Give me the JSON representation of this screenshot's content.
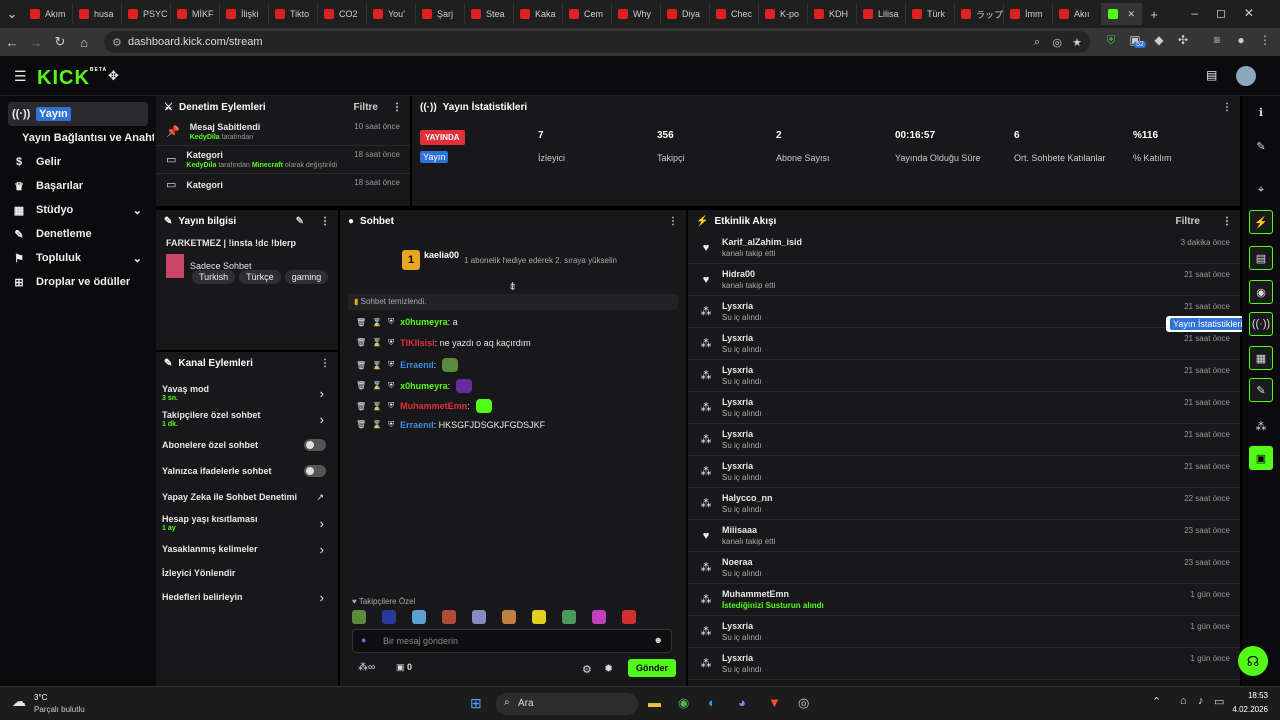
{
  "browser": {
    "tabs": [
      "Akım",
      "husa",
      "PSYC",
      "MİKF",
      "İlişki",
      "Tikto",
      "CO2",
      "You'",
      "Şarj",
      "Stea",
      "Kaka",
      "Cem",
      "Why",
      "Diya",
      "Chec",
      "K-po",
      "KDH",
      "Lilisa",
      "Türk",
      "ラップ",
      "İmm",
      "Akıı"
    ],
    "url": "dashboard.kick.com/stream",
    "extension_badge": "52"
  },
  "topnav": {
    "logo": "KICK",
    "beta": "BETA"
  },
  "sidebar": {
    "items": [
      {
        "label": "Yayın",
        "icon": "broadcast-icon",
        "active": true
      },
      {
        "label": "Yayın Bağlantısı ve Anahtarı",
        "icon": "",
        "sub": true
      },
      {
        "label": "Gelir",
        "icon": "dollar-icon"
      },
      {
        "label": "Başarılar",
        "icon": "trophy-icon"
      },
      {
        "label": "Stüdyo",
        "icon": "studio-icon",
        "chevron": true
      },
      {
        "label": "Denetleme",
        "icon": "wrench-icon"
      },
      {
        "label": "Topluluk",
        "icon": "community-icon",
        "chevron": true
      },
      {
        "label": "Droplar ve ödüller",
        "icon": "gift-icon"
      }
    ]
  },
  "mod_actions": {
    "title": "Denetim Eylemleri",
    "filter": "Filtre",
    "items": [
      {
        "title": "Mesaj Sabitlendi",
        "user": "KedyDila",
        "detail": "tarafından",
        "time": "10 saat önce"
      },
      {
        "title": "Kategori",
        "user": "KedyDila",
        "detail": "tarafından",
        "game": "Minecraft",
        "detail2": "olarak değiştirildi",
        "time": "18 saat önce"
      },
      {
        "title": "Kategori",
        "time": "18 saat önce"
      }
    ]
  },
  "stream_stats": {
    "title": "Yayın İstatistikleri",
    "live_badge": "YAYINDA",
    "live_label": "Yayın",
    "stats": [
      {
        "value": "7",
        "label": "İzleyici"
      },
      {
        "value": "356",
        "label": "Takipçi"
      },
      {
        "value": "2",
        "label": "Abone Sayısı"
      },
      {
        "value": "00:16:57",
        "label": "Yayında Olduğu Süre"
      },
      {
        "value": "6",
        "label": "Ort. Sohbete Katılanlar"
      },
      {
        "value": "%116",
        "label": "% Katılım"
      }
    ]
  },
  "stream_info": {
    "title": "Yayın bilgisi",
    "stream_title": "FARKETMEZ | !insta !dc !blerp",
    "category": "Sadece Sohbet",
    "tags": [
      "Turkish",
      "Türkçe",
      "gaming"
    ]
  },
  "channel_actions": {
    "title": "Kanal Eylemleri",
    "items": [
      {
        "label": "Yavaş mod",
        "sub": "3 sn.",
        "control": "chevron"
      },
      {
        "label": "Takipçilere özel sohbet",
        "sub": "1 dk.",
        "control": "chevron"
      },
      {
        "label": "Abonelere özel sohbet",
        "control": "toggle"
      },
      {
        "label": "Yalnızca ifadelerle sohbet",
        "control": "toggle"
      },
      {
        "label": "Yapay Zeka ile Sohbet Denetimi",
        "control": "external"
      },
      {
        "label": "Hesap yaşı kısıtlaması",
        "sub": "1 ay",
        "control": "chevron"
      },
      {
        "label": "Yasaklanmış kelimeler",
        "control": "chevron"
      },
      {
        "label": "İzleyici Yönlendir",
        "control": "none"
      },
      {
        "label": "Hedefleri belirleyin",
        "control": "chevron"
      }
    ]
  },
  "chat": {
    "title": "Sohbet",
    "gifter": {
      "name": "kaelia00",
      "rank": "1",
      "message": "1 abonelik hediye ederek 2. sıraya yükselin"
    },
    "cleared": "Sohbet temizlendi.",
    "messages": [
      {
        "user": "x0humeyra",
        "color": "#53fc18",
        "text": "a"
      },
      {
        "user": "TIKIlsisi",
        "color": "#e0303a",
        "text": "ne yazdı o aq kaçırdım"
      },
      {
        "user": "Erraenıl",
        "color": "#3a8ee6",
        "text": ""
      },
      {
        "user": "x0humeyra",
        "color": "#53fc18",
        "text": ""
      },
      {
        "user": "MuhammetEmn",
        "color": "#e0303a",
        "text": ""
      },
      {
        "user": "Erraenıl",
        "color": "#3a8ee6",
        "text": "HKSGFJDSGKJFGDSJKF"
      }
    ],
    "followers_only": "Takipçilere Özel",
    "placeholder": "Bir mesaj gönderin",
    "count": "0",
    "send": "Gönder"
  },
  "activity": {
    "title": "Etkinlik Akışı",
    "filter": "Filtre",
    "items": [
      {
        "name": "Karif_alZahim_isid",
        "sub": "kanalı takip etti",
        "time": "3 dakika önce",
        "icon": "heart-icon"
      },
      {
        "name": "Hidra00",
        "sub": "kanalı takip etti",
        "time": "21 saat önce",
        "icon": "heart-icon"
      },
      {
        "name": "Lysxria",
        "sub": "Su iç alındı",
        "time": "21 saat önce",
        "icon": "points-icon"
      },
      {
        "name": "Lysxria",
        "sub": "Su iç alındı",
        "time": "21 saat önce",
        "icon": "points-icon"
      },
      {
        "name": "Lysxria",
        "sub": "Su iç alındı",
        "time": "21 saat önce",
        "icon": "points-icon"
      },
      {
        "name": "Lysxria",
        "sub": "Su iç alındı",
        "time": "21 saat önce",
        "icon": "points-icon"
      },
      {
        "name": "Lysxria",
        "sub": "Su iç alındı",
        "time": "21 saat önce",
        "icon": "points-icon"
      },
      {
        "name": "Lysxria",
        "sub": "Su iç alındı",
        "time": "21 saat önce",
        "icon": "points-icon"
      },
      {
        "name": "Halycco_nn",
        "sub": "Su iç alındı",
        "time": "22 saat önce",
        "icon": "points-icon"
      },
      {
        "name": "Miiisaaa",
        "sub": "kanalı takip etti",
        "time": "23 saat önce",
        "icon": "heart-icon"
      },
      {
        "name": "Noeraa",
        "sub": "Su iç alındı",
        "time": "23 saat önce",
        "icon": "points-icon"
      },
      {
        "name": "MuhammetEmn",
        "sub": "İstediğinizi Susturun alındı",
        "time": "1 gün önce",
        "icon": "points-icon"
      },
      {
        "name": "Lysxria",
        "sub": "Su iç alındı",
        "time": "1 gün önce",
        "icon": "points-icon"
      },
      {
        "name": "Lysxria",
        "sub": "Su iç alındı",
        "time": "1 gün önce",
        "icon": "points-icon"
      }
    ]
  },
  "tooltip": "Yayın İstatistikleri",
  "taskbar": {
    "weather_temp": "3°C",
    "weather_desc": "Parçalı bulutlu",
    "search": "Ara",
    "time": "18:53",
    "date": "4.02.2026"
  }
}
